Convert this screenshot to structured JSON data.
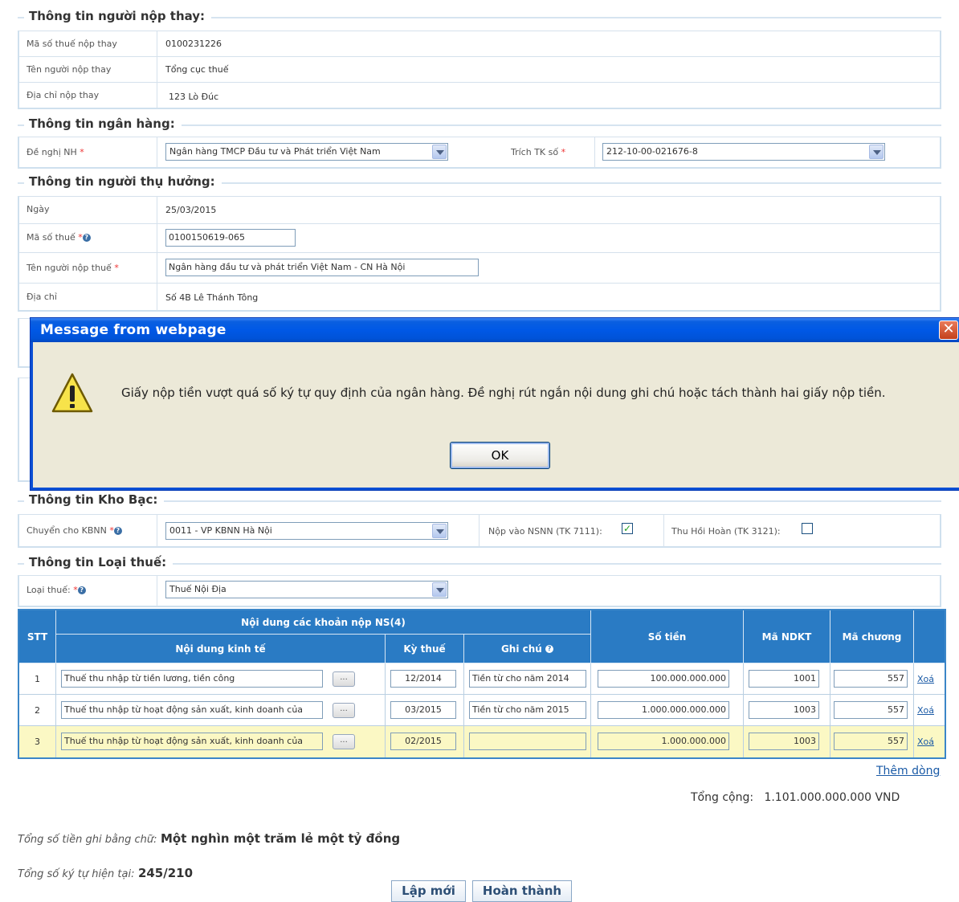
{
  "sections": {
    "payer_substitute": {
      "title": "Thông tin người nộp thay:",
      "rows": [
        {
          "label": "Mã số thuế nộp thay",
          "value": "0100231226"
        },
        {
          "label": "Tên người nộp thay",
          "value": "Tổng cục thuế"
        },
        {
          "label": "Địa chỉ nộp thay",
          "value": "123 Lò Đúc"
        }
      ]
    },
    "bank": {
      "title": "Thông tin ngân hàng:",
      "bank_label": "Đề nghị NH",
      "bank_value": "Ngân hàng TMCP Đầu tư và Phát triển Việt Nam",
      "account_label": "Trích TK số",
      "account_value": "212-10-00-021676-8"
    },
    "beneficiary": {
      "title": "Thông tin người thụ hưởng:",
      "date_label": "Ngày",
      "date_value": "25/03/2015",
      "tax_code_label": "Mã số thuế",
      "tax_code_value": "0100150619-065",
      "taxpayer_label": "Tên người nộp thuế",
      "taxpayer_value": "Ngân hàng đầu tư và phát triển Việt Nam - CN Hà Nội",
      "address_label": "Địa chỉ",
      "address_value": "Số 4B Lê Thánh Tông"
    },
    "treasury": {
      "title": "Thông tin Kho Bạc:",
      "kbnn_label": "Chuyển cho KBNN",
      "kbnn_value": "0011 - VP KBNN Hà Nội",
      "nsnn_label": "Nộp vào NSNN (TK 7111):",
      "nsnn_checked": "✓",
      "refund_label": "Thu Hồi Hoàn (TK 3121):"
    },
    "tax_type": {
      "title": "Thông tin Loại thuế:",
      "label": "Loại thuế:",
      "value": "Thuế Nội Địa"
    }
  },
  "table": {
    "headers": {
      "stt": "STT",
      "group": "Nội dung các khoản nộp NS(4)",
      "content": "Nội dung kinh tế",
      "period": "Kỳ thuế",
      "note": "Ghi chú",
      "amount": "Số tiền",
      "ndkt": "Mã NDKT",
      "chapter": "Mã chương"
    },
    "rows": [
      {
        "stt": "1",
        "content": "Thuế thu nhập từ tiền lương, tiền công",
        "period": "12/2014",
        "note": "Tiền từ cho năm 2014",
        "amount": "100.000.000.000",
        "ndkt": "1001",
        "chapter": "557",
        "delete": "Xoá"
      },
      {
        "stt": "2",
        "content": "Thuế thu nhập từ hoạt động sản xuất, kinh doanh của",
        "period": "03/2015",
        "note": "Tiền từ cho năm 2015",
        "amount": "1.000.000.000.000",
        "ndkt": "1003",
        "chapter": "557",
        "delete": "Xoá"
      },
      {
        "stt": "3",
        "content": "Thuế thu nhập từ hoạt động sản xuất, kinh doanh của",
        "period": "02/2015",
        "note": "",
        "amount": "1.000.000.000",
        "ndkt": "1003",
        "chapter": "557",
        "delete": "Xoá"
      }
    ],
    "ellipsis": "...",
    "add_row": "Thêm dòng",
    "total_label": "Tổng cộng:",
    "total_value": "1.101.000.000.000 VND"
  },
  "summary": {
    "words_label": "Tổng số tiền ghi bằng chữ:",
    "words_value": "Một nghìn một trăm lẻ một tỷ đồng",
    "chars_label": "Tổng số ký tự hiện tại:",
    "chars_value": "245/210"
  },
  "buttons": {
    "new": "Lập mới",
    "done": "Hoàn thành"
  },
  "dialog": {
    "title": "Message from webpage",
    "message": "Giấy nộp tiền vượt quá số ký tự quy định của ngân hàng. Đề nghị rút ngắn nội dung ghi chú hoặc tách thành hai giấy nộp tiền.",
    "ok": "OK",
    "close": "✕",
    "icon": "warning-icon"
  }
}
